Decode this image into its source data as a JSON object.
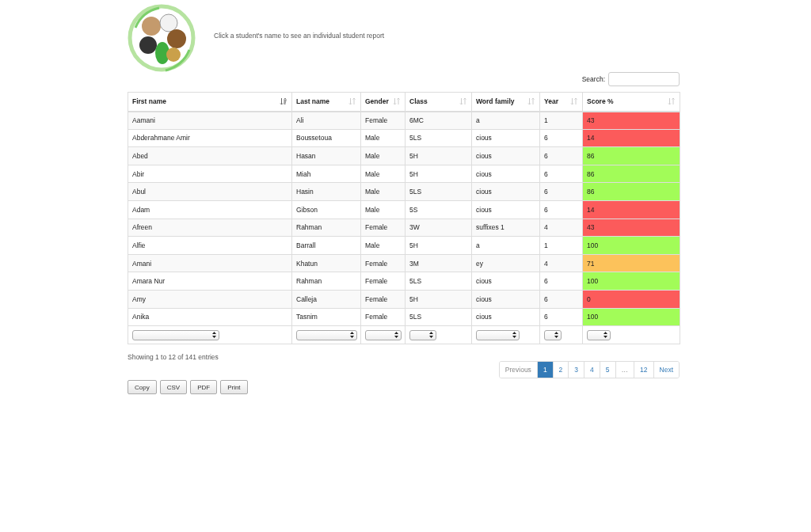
{
  "header": {
    "instruction": "Click a student's name to see an individual student report"
  },
  "search": {
    "label": "Search:"
  },
  "table": {
    "columns": [
      {
        "label": "First name",
        "sorted": true
      },
      {
        "label": "Last name",
        "sorted": false
      },
      {
        "label": "Gender",
        "sorted": false
      },
      {
        "label": "Class",
        "sorted": false
      },
      {
        "label": "Word family",
        "sorted": false
      },
      {
        "label": "Year",
        "sorted": false
      },
      {
        "label": "Score %",
        "sorted": false
      }
    ],
    "rows": [
      {
        "cells": [
          "Aamani",
          "Ali",
          "Female",
          "6MC",
          "a",
          "1"
        ],
        "score": "43",
        "color": "#fc5b5b"
      },
      {
        "cells": [
          "Abderahmane Amir",
          "Boussetoua",
          "Male",
          "5LS",
          "cious",
          "6"
        ],
        "score": "14",
        "color": "#fc5b5b"
      },
      {
        "cells": [
          "Abed",
          "Hasan",
          "Male",
          "5H",
          "cious",
          "6"
        ],
        "score": "86",
        "color": "#a2fc58"
      },
      {
        "cells": [
          "Abir",
          "Miah",
          "Male",
          "5H",
          "cious",
          "6"
        ],
        "score": "86",
        "color": "#a2fc58"
      },
      {
        "cells": [
          "Abul",
          "Hasin",
          "Male",
          "5LS",
          "cious",
          "6"
        ],
        "score": "86",
        "color": "#a2fc58"
      },
      {
        "cells": [
          "Adam",
          "Gibson",
          "Male",
          "5S",
          "cious",
          "6"
        ],
        "score": "14",
        "color": "#fc5b5b"
      },
      {
        "cells": [
          "Afreen",
          "Rahman",
          "Female",
          "3W",
          "suffixes 1",
          "4"
        ],
        "score": "43",
        "color": "#fc5b5b"
      },
      {
        "cells": [
          "Alfie",
          "Barrall",
          "Male",
          "5H",
          "a",
          "1"
        ],
        "score": "100",
        "color": "#a2fc58"
      },
      {
        "cells": [
          "Amani",
          "Khatun",
          "Female",
          "3M",
          "ey",
          "4"
        ],
        "score": "71",
        "color": "#fcc25b"
      },
      {
        "cells": [
          "Amara Nur",
          "Rahman",
          "Female",
          "5LS",
          "cious",
          "6"
        ],
        "score": "100",
        "color": "#a2fc58"
      },
      {
        "cells": [
          "Amy",
          "Calleja",
          "Female",
          "5H",
          "cious",
          "6"
        ],
        "score": "0",
        "color": "#fc5b5b"
      },
      {
        "cells": [
          "Anika",
          "Tasnim",
          "Female",
          "5LS",
          "cious",
          "6"
        ],
        "score": "100",
        "color": "#a2fc58"
      }
    ]
  },
  "info": "Showing 1 to 12 of 141 entries",
  "pagination": [
    {
      "label": "Previous",
      "selected": false,
      "disabled": true
    },
    {
      "label": "1",
      "selected": true,
      "disabled": false
    },
    {
      "label": "2",
      "selected": false,
      "disabled": false
    },
    {
      "label": "3",
      "selected": false,
      "disabled": false
    },
    {
      "label": "4",
      "selected": false,
      "disabled": false
    },
    {
      "label": "5",
      "selected": false,
      "disabled": false
    },
    {
      "label": "…",
      "selected": false,
      "disabled": true
    },
    {
      "label": "12",
      "selected": false,
      "disabled": false
    },
    {
      "label": "Next",
      "selected": false,
      "disabled": false
    }
  ],
  "export_buttons": [
    "Copy",
    "CSV",
    "PDF",
    "Print"
  ]
}
